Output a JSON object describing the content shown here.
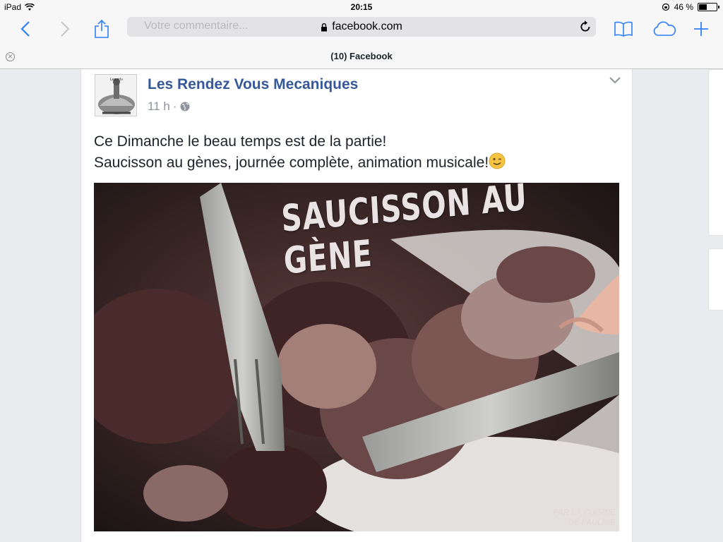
{
  "status_bar": {
    "device": "iPad",
    "time": "20:15",
    "battery": "46 %",
    "battery_fraction": 0.46
  },
  "toolbar": {
    "url": "facebook.com",
    "ghost_text": "Votre commentaire..."
  },
  "tab": {
    "title": "(10) Facebook"
  },
  "post": {
    "page_name": "Les Rendez Vous Mecaniques",
    "time": "11 h",
    "separator": "·",
    "text_lines": [
      "Ce Dimanche le beau temps est de la partie!",
      "Saucisson au gènes, journée complète, animation musicale!"
    ],
    "photo": {
      "title": "SAUCISSON AU GÈNE",
      "credit_lines": [
        "PAR LA CUISINE",
        "DE PAULINE"
      ]
    }
  },
  "colors": {
    "link": "#365899",
    "ios_blue": "#2f7ff7",
    "feed_bg": "#e9ebee"
  },
  "icons": [
    "wifi-icon",
    "back-icon",
    "forward-icon",
    "share-icon",
    "lock-icon",
    "reload-icon",
    "bookmarks-icon",
    "icloud-tabs-icon",
    "new-tab-icon",
    "close-tab-icon",
    "globe-icon",
    "chevron-down-icon",
    "wink-emoji-icon"
  ]
}
